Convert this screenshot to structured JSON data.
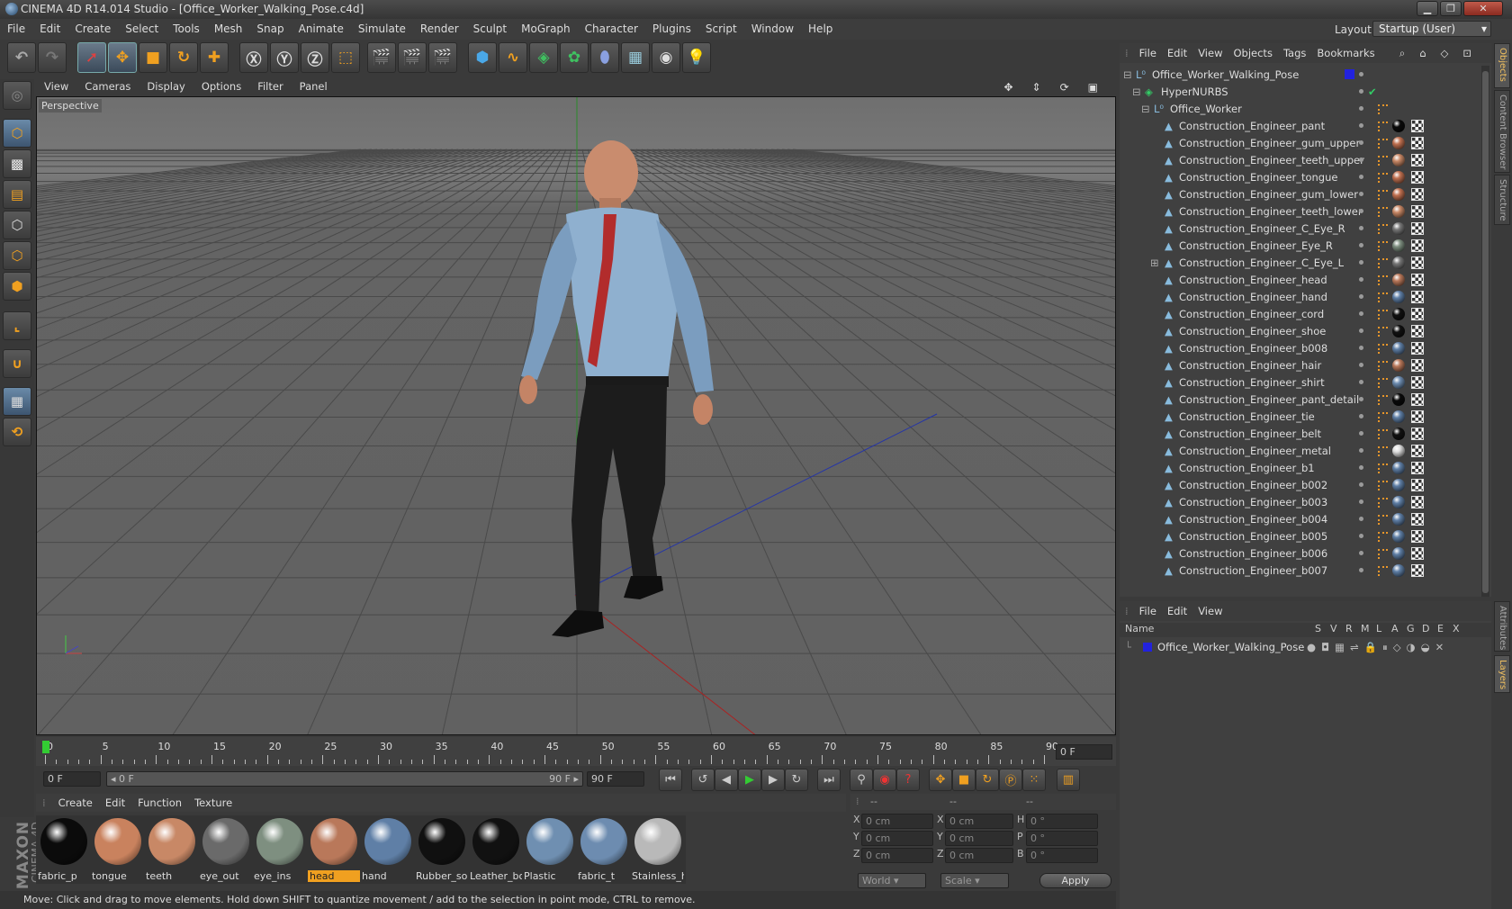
{
  "window": {
    "title": "CINEMA 4D R14.014 Studio - [Office_Worker_Walking_Pose.c4d]"
  },
  "menubar": [
    "File",
    "Edit",
    "Create",
    "Select",
    "Tools",
    "Mesh",
    "Snap",
    "Animate",
    "Simulate",
    "Render",
    "Sculpt",
    "MoGraph",
    "Character",
    "Plugins",
    "Script",
    "Window",
    "Help"
  ],
  "layout": {
    "label": "Layout:",
    "value": "Startup (User)"
  },
  "viewport": {
    "menu": [
      "View",
      "Cameras",
      "Display",
      "Options",
      "Filter",
      "Panel"
    ],
    "label": "Perspective"
  },
  "timeline": {
    "ticks": [
      "0",
      "5",
      "10",
      "15",
      "20",
      "25",
      "30",
      "35",
      "40",
      "45",
      "50",
      "55",
      "60",
      "65",
      "70",
      "75",
      "80",
      "85",
      "90"
    ],
    "end_field": "0 F"
  },
  "transport": {
    "start": "0 F",
    "range_start": "◂ 0 F",
    "range_end": "90 F ▸",
    "end": "90 F"
  },
  "materials": {
    "menu": [
      "Create",
      "Edit",
      "Function",
      "Texture"
    ],
    "items": [
      {
        "name": "fabric_p",
        "color": "#0b0b0b"
      },
      {
        "name": "tongue",
        "color": "#c9825e"
      },
      {
        "name": "teeth",
        "color": "#c88866"
      },
      {
        "name": "eye_out",
        "color": "#6a6a6a"
      },
      {
        "name": "eye_ins",
        "color": "#7e8f80"
      },
      {
        "name": "head",
        "color": "#b9785a"
      },
      {
        "name": "hand",
        "color": "#5f7fa6"
      },
      {
        "name": "Rubber_so",
        "color": "#101010"
      },
      {
        "name": "Leather_bo",
        "color": "#111111"
      },
      {
        "name": "Plastic",
        "color": "#6f8fb1"
      },
      {
        "name": "fabric_t",
        "color": "#6d8cb0"
      },
      {
        "name": "Stainless_h",
        "color": "#b9b9b9"
      }
    ],
    "selected": "head"
  },
  "attributes": {
    "headers": [
      "--",
      "--",
      "--"
    ],
    "rows": [
      {
        "a": "X",
        "av": "0 cm",
        "b": "X",
        "bv": "0 cm",
        "c": "H",
        "cv": "0 °"
      },
      {
        "a": "Y",
        "av": "0 cm",
        "b": "Y",
        "bv": "0 cm",
        "c": "P",
        "cv": "0 °"
      },
      {
        "a": "Z",
        "av": "0 cm",
        "b": "Z",
        "bv": "0 cm",
        "c": "B",
        "cv": "0 °"
      }
    ],
    "mode1": "World",
    "mode2": "Scale",
    "apply": "Apply"
  },
  "status": "Move: Click and drag to move elements. Hold down SHIFT to quantize movement / add to the selection in point mode, CTRL to remove.",
  "objects": {
    "menu": [
      "File",
      "Edit",
      "View",
      "Objects",
      "Tags",
      "Bookmarks"
    ],
    "root": "Office_Worker_Walking_Pose",
    "hypernurbs": "HyperNURBS",
    "group": "Office_Worker",
    "children": [
      {
        "name": "Construction_Engineer_pant",
        "mat": "#0a0a0a"
      },
      {
        "name": "Construction_Engineer_gum_upper",
        "mat": "#c07050"
      },
      {
        "name": "Construction_Engineer_teeth_upper",
        "mat": "#c88866"
      },
      {
        "name": "Construction_Engineer_tongue",
        "mat": "#c07050"
      },
      {
        "name": "Construction_Engineer_gum_lower",
        "mat": "#c07050"
      },
      {
        "name": "Construction_Engineer_teeth_lower",
        "mat": "#c88866"
      },
      {
        "name": "Construction_Engineer_C_Eye_R",
        "mat": "#777777"
      },
      {
        "name": "Construction_Engineer_Eye_R",
        "mat": "#7e8f80"
      },
      {
        "name": "Construction_Engineer_C_Eye_L",
        "mat": "#777777"
      },
      {
        "name": "Construction_Engineer_head",
        "mat": "#b9785a"
      },
      {
        "name": "Construction_Engineer_hand",
        "mat": "#5f7fa6"
      },
      {
        "name": "Construction_Engineer_cord",
        "mat": "#101010"
      },
      {
        "name": "Construction_Engineer_shoe",
        "mat": "#111111"
      },
      {
        "name": "Construction_Engineer_b008",
        "mat": "#5f7fa6"
      },
      {
        "name": "Construction_Engineer_hair",
        "mat": "#b9785a"
      },
      {
        "name": "Construction_Engineer_shirt",
        "mat": "#6d8cb0"
      },
      {
        "name": "Construction_Engineer_pant_detail",
        "mat": "#0a0a0a"
      },
      {
        "name": "Construction_Engineer_tie",
        "mat": "#5f7fa6"
      },
      {
        "name": "Construction_Engineer_belt",
        "mat": "#111111"
      },
      {
        "name": "Construction_Engineer_metal",
        "mat": "#dddddd"
      },
      {
        "name": "Construction_Engineer_b1",
        "mat": "#5f7fa6"
      },
      {
        "name": "Construction_Engineer_b002",
        "mat": "#5f7fa6"
      },
      {
        "name": "Construction_Engineer_b003",
        "mat": "#5f7fa6"
      },
      {
        "name": "Construction_Engineer_b004",
        "mat": "#5f7fa6"
      },
      {
        "name": "Construction_Engineer_b005",
        "mat": "#5f7fa6"
      },
      {
        "name": "Construction_Engineer_b006",
        "mat": "#5f7fa6"
      },
      {
        "name": "Construction_Engineer_b007",
        "mat": "#5f7fa6"
      }
    ]
  },
  "layers": {
    "menu": [
      "File",
      "Edit",
      "View"
    ],
    "columns": [
      "Name",
      "S",
      "V",
      "R",
      "M",
      "L",
      "A",
      "G",
      "D",
      "E",
      "X"
    ],
    "row": "Office_Worker_Walking_Pose"
  },
  "side_tabs": [
    "Objects",
    "Content Browser",
    "Structure",
    "Attributes",
    "Layers"
  ]
}
